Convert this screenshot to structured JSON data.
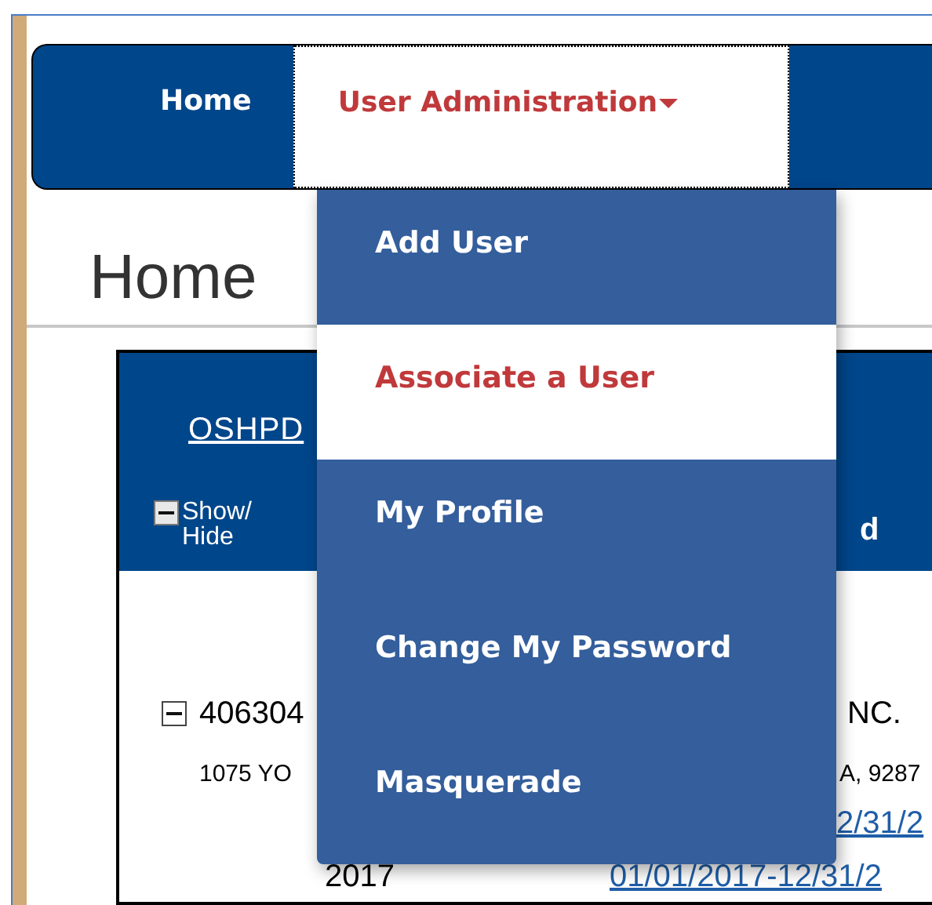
{
  "nav": {
    "items": [
      {
        "label": "Home",
        "selected": false,
        "has_caret": false
      },
      {
        "label": "User Administration",
        "selected": true,
        "has_caret": true
      }
    ]
  },
  "dropdown": {
    "items": [
      {
        "label": "Add User",
        "selected": false
      },
      {
        "label": "Associate a User",
        "selected": true
      },
      {
        "label": "My Profile",
        "selected": false
      },
      {
        "label": "Change My Password",
        "selected": false
      },
      {
        "label": "Masquerade",
        "selected": false
      }
    ]
  },
  "page": {
    "heading": "Home"
  },
  "panel": {
    "header": {
      "link": "OSHPD",
      "toggle": {
        "label": "Show/ Hide",
        "expanded": true
      },
      "column_2": "d"
    },
    "facility": {
      "expanded": true,
      "number": "406304",
      "name": "NC.",
      "address_left": "1075 YO",
      "address_right": "A, 9287",
      "period_link": "2/31/2"
    },
    "year_row": {
      "year": "2017",
      "period_link": "01/01/2017-12/31/2"
    }
  }
}
